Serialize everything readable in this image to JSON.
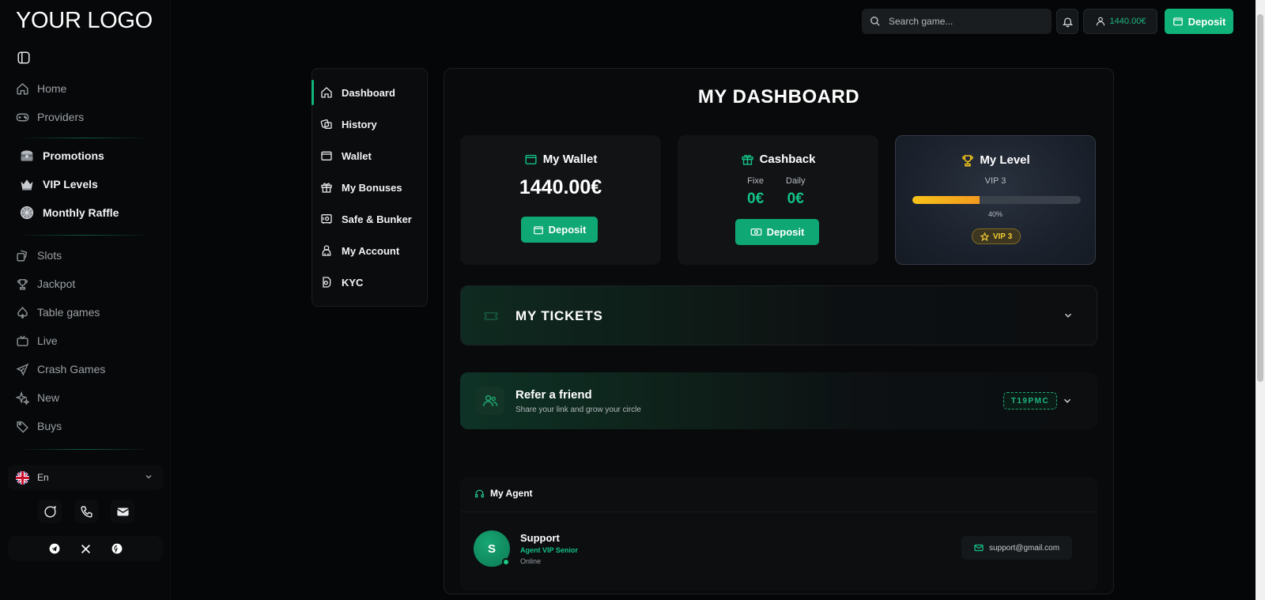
{
  "brand": {
    "logo": "YOUR LOGO"
  },
  "sidebar": {
    "nav_top": [
      {
        "label": "Home",
        "icon": "home-icon"
      },
      {
        "label": "Providers",
        "icon": "gamepad-icon"
      }
    ],
    "nav_promo": [
      {
        "label": "Promotions",
        "icon": "treasure-chest-icon"
      },
      {
        "label": "VIP Levels",
        "icon": "crown-icon"
      },
      {
        "label": "Monthly Raffle",
        "icon": "raffle-wheel-icon"
      }
    ],
    "nav_games": [
      {
        "label": "Slots",
        "icon": "slots-icon"
      },
      {
        "label": "Jackpot",
        "icon": "trophy-icon"
      },
      {
        "label": "Table games",
        "icon": "spade-icon"
      },
      {
        "label": "Live",
        "icon": "tv-icon"
      },
      {
        "label": "Crash Games",
        "icon": "plane-icon"
      },
      {
        "label": "New",
        "icon": "sparkles-icon"
      },
      {
        "label": "Buys",
        "icon": "tag-icon"
      }
    ],
    "language": {
      "label": "En",
      "icon": "uk-flag-icon"
    }
  },
  "header": {
    "search_placeholder": "Search game...",
    "balance": "1440.00€",
    "deposit_label": "Deposit"
  },
  "account_menu": {
    "items": [
      {
        "label": "Dashboard",
        "icon": "home-icon",
        "active": true
      },
      {
        "label": "History",
        "icon": "history-icon"
      },
      {
        "label": "Wallet",
        "icon": "wallet-icon"
      },
      {
        "label": "My Bonuses",
        "icon": "gift-icon"
      },
      {
        "label": "Safe & Bunker",
        "icon": "safe-icon"
      },
      {
        "label": "My Account",
        "icon": "user-icon"
      },
      {
        "label": "KYC",
        "icon": "id-icon"
      }
    ]
  },
  "dashboard": {
    "title": "MY DASHBOARD",
    "wallet": {
      "title": "My Wallet",
      "amount": "1440.00€",
      "button": "Deposit"
    },
    "cashback": {
      "title": "Cashback",
      "fixe_label": "Fixe",
      "fixe_value": "0€",
      "daily_label": "Daily",
      "daily_value": "0€",
      "button": "Deposit"
    },
    "level": {
      "title": "My Level",
      "vip": "VIP 3",
      "progress_percent": 40,
      "progress_label": "40%",
      "badge": "VIP 3"
    },
    "tickets": {
      "title": "MY TICKETS"
    },
    "refer": {
      "title": "Refer a friend",
      "subtitle": "Share your link and grow your circle",
      "code": "T19PMC"
    },
    "agent": {
      "section_title": "My Agent",
      "initial": "S",
      "name": "Support",
      "role": "Agent VIP Senior",
      "status": "Online",
      "email": "support@gmail.com"
    }
  },
  "colors": {
    "accent": "#11b27a",
    "background": "#050607",
    "gold": "#f5cd34"
  }
}
